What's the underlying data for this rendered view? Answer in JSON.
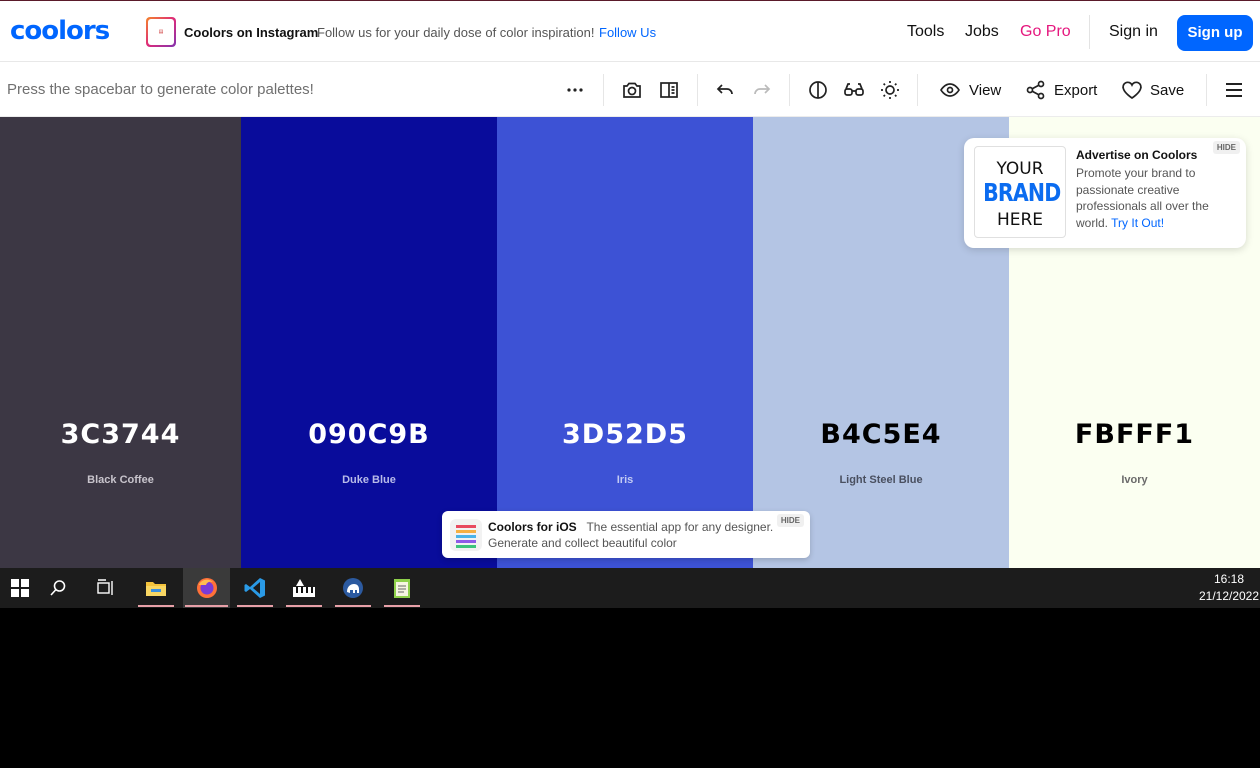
{
  "nav": {
    "logo": "coolors",
    "instagram_title": "Coolors on Instagram",
    "instagram_text": "Follow us for your daily dose of color inspiration!",
    "instagram_link": "Follow Us",
    "tools": "Tools",
    "jobs": "Jobs",
    "gopro": "Go Pro",
    "signin": "Sign in",
    "signup": "Sign up"
  },
  "toolbar": {
    "hint": "Press the spacebar to generate color palettes!",
    "view": "View",
    "export": "Export",
    "save": "Save"
  },
  "palette": [
    {
      "hex": "3C3744",
      "name": "Black Coffee",
      "color": "#3C3744",
      "text_color": "#ffffff",
      "name_color": "#c8c4cc"
    },
    {
      "hex": "090C9B",
      "name": "Duke Blue",
      "color": "#090C9B",
      "text_color": "#ffffff",
      "name_color": "#b8bbe8"
    },
    {
      "hex": "3D52D5",
      "name": "Iris",
      "color": "#3D52D5",
      "text_color": "#ffffff",
      "name_color": "#c3cbf3"
    },
    {
      "hex": "B4C5E4",
      "name": "Light Steel Blue",
      "color": "#B4C5E4",
      "text_color": "#000000",
      "name_color": "#4a5060"
    },
    {
      "hex": "FBFFF1",
      "name": "Ivory",
      "color": "#FBFFF1",
      "text_color": "#000000",
      "name_color": "#6a6a6a"
    }
  ],
  "ad": {
    "img_line1": "YOUR",
    "img_line2": "BRAND",
    "img_line3": "HERE",
    "title": "Advertise on Coolors",
    "text": "Promote your brand to passionate creative professionals all over the world.",
    "link": "Try It Out!",
    "hide": "HIDE"
  },
  "ios": {
    "title": "Coolors for iOS",
    "text": "The essential app for any designer. Generate and collect beautiful color",
    "hide": "HIDE"
  },
  "taskbar": {
    "time": "16:18",
    "date": "21/12/2022"
  }
}
